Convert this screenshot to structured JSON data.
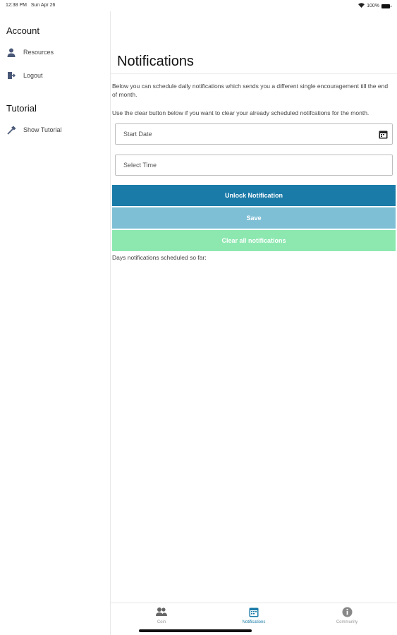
{
  "status_bar": {
    "time": "12:38 PM",
    "date": "Sun Apr 26",
    "battery": "100%"
  },
  "sidebar": {
    "account_title": "Account",
    "resources_label": "Resources",
    "logout_label": "Logout",
    "tutorial_title": "Tutorial",
    "show_tutorial_label": "Show Tutorial"
  },
  "main": {
    "title": "Notifications",
    "description1": "Below you can schedule daily notifications which sends you a different single encouragement till the end of month.",
    "description2": "Use the clear button below if you want to clear your already scheduled notifcations for the month.",
    "start_date_placeholder": "Start Date",
    "select_time_placeholder": "Select Time",
    "unlock_button": "Unlock Notification",
    "save_button": "Save",
    "clear_button": "Clear all notifications",
    "scheduled_text": "Days notifications scheduled so far:"
  },
  "tabs": {
    "coin": "Coin",
    "notifications": "Notifications",
    "community": "Community"
  },
  "colors": {
    "accent": "#1b7ba8",
    "save": "#7fbfd6",
    "clear": "#8de8b0"
  },
  "icons": {
    "resources": "person-icon",
    "logout": "logout-icon",
    "tutorial": "hammer-icon",
    "calendar": "calendar-icon",
    "coin_tab": "people-icon",
    "notifications_tab": "calendar-icon",
    "community_tab": "info-icon"
  }
}
